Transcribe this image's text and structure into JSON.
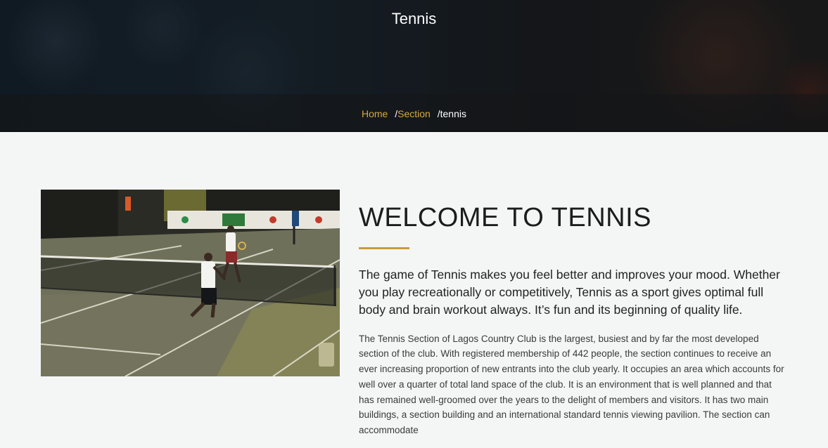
{
  "hero": {
    "title": "Tennis",
    "breadcrumb": {
      "home": "Home",
      "section": "Section",
      "separator": "/",
      "current": "tennis"
    }
  },
  "main": {
    "image_alt": "Players on a tennis court at night",
    "heading": "WELCOME TO TENNIS",
    "lead": "The game of Tennis makes you feel better and improves your mood. Whether you play recreationally or competitively, Tennis as a sport gives optimal full body and brain workout always. It’s fun and its beginning of quality life.",
    "body": "The Tennis Section of Lagos Country Club is the largest, busiest and by far the most developed section of the club. With registered membership of 442 people, the section continues to receive an ever increasing proportion of new entrants into the club yearly. It occupies an area which accounts for well over a quarter of total land space of the club. It is an environment that is well planned and that has remained well-groomed over the years to the delight of members and visitors. It has two main buildings, a section building and an international standard tennis viewing pavilion. The section can accommodate"
  },
  "colors": {
    "accent": "#d7a941",
    "rule": "#c89b3c",
    "page_bg": "#f4f6f5",
    "heading": "#1c1c1c"
  }
}
